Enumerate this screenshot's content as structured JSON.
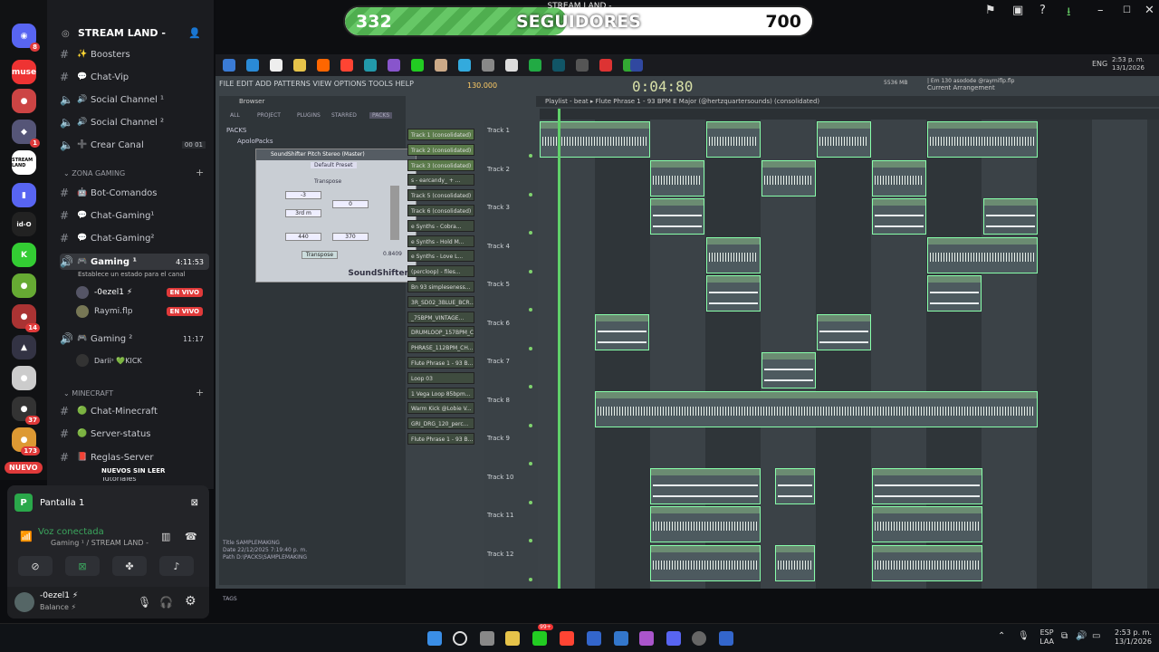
{
  "overlay": {
    "stream_title": "STREAM LAND -",
    "current": "332",
    "label": "SEGUIDORES",
    "goal": "700",
    "fill_fraction": 0.474
  },
  "servers": {
    "discord_badge": "8",
    "muse": "muse",
    "badge1": "1",
    "badge37": "37",
    "badge173": "173",
    "badge14": "14",
    "nuevo": "NUEVO",
    "id0": "id-O",
    "stream": "STREAM LAND"
  },
  "guild": {
    "name": "STREAM LAND -"
  },
  "channels": [
    {
      "name": "Boosters",
      "emoji": "✨"
    },
    {
      "name": "Chat-Vip",
      "emoji": "💬"
    },
    {
      "name": "Social Channel ¹",
      "emoji": "🔊"
    },
    {
      "name": "Social Channel ²",
      "emoji": "🔊"
    },
    {
      "name": "Crear Canal",
      "emoji": "➕",
      "count": "00",
      "count2": "01"
    }
  ],
  "cat_gaming": "ZONA GAMING",
  "gaming_channels": [
    {
      "name": "Bot-Comandos",
      "emoji": "🤖"
    },
    {
      "name": "Chat-Gaming¹",
      "emoji": "💬"
    },
    {
      "name": "Chat-Gaming²",
      "emoji": "💬"
    }
  ],
  "voice1": {
    "name": "Gaming ¹",
    "time": "4:11:53",
    "status": "Establece un estado para el canal"
  },
  "voice1_users": [
    {
      "name": "-0ezel1 ⚡",
      "live": "EN VIVO"
    },
    {
      "name": "Raymi.flp",
      "live": "EN VIVO"
    }
  ],
  "voice2": {
    "name": "Gaming ²",
    "time": "11:17"
  },
  "voice2_user": {
    "name": "Dariiˢ 💚KICK"
  },
  "cat_minecraft": "MINECRAFT",
  "mc_channels": [
    {
      "name": "Chat-Minecraft",
      "emoji": "🟢"
    },
    {
      "name": "Server-status",
      "emoji": "🟢"
    },
    {
      "name": "Reglas-Server",
      "emoji": "📕"
    }
  ],
  "tutoriales": "Tutoriales",
  "new_unread": "NUEVOS SIN LEER",
  "screen": {
    "label": "Pantalla 1"
  },
  "voice_conn": {
    "title": "Voz conectada",
    "sub": "Gaming ¹ / STREAM LAND -"
  },
  "user": {
    "name": "-0ezel1 ⚡",
    "status": "Balance ⚡"
  },
  "fl": {
    "menu": "FILE  EDIT  ADD  PATTERNS  VIEW  OPTIONS  TOOLS  HELP",
    "tempo": "130.000",
    "time": "0:04:80",
    "hint": "Current Arrangement",
    "hint2": "| Em 130 asodode @raymiflp.flp",
    "mem": "5536 MB",
    "browser_title": "Browser",
    "tabs": [
      "ALL",
      "PROJECT",
      "PLUGINS",
      "STARRED",
      "PACKS"
    ],
    "packs": [
      "PACKS",
      "ApoloPacks"
    ],
    "plugin_title": "SoundShifter Pitch Stereo (Master)",
    "plugin_preset": "Default Preset",
    "plugin_name": "SoundShifter",
    "plugin_fields": {
      "transpose": "Transpose",
      "semitones": "-3",
      "cents": "0",
      "interval": "3rd m",
      "source": "440",
      "dest": "370",
      "ratio": "0.8409",
      "mode": "Transpose"
    },
    "fileinfo": [
      "Title   SAMPLEMAKING",
      "Date    22/12/2025 7:19:40 p. m.",
      "Path    D:\\PACKS\\SAMPLEMAKING"
    ],
    "tags": "TAGS",
    "playlist": "Playlist - beat ▸ Flute Phrase 1 - 93 BPM E Major (@hertzquartersounds) (consolidated)",
    "rack": [
      "Track 1 (consolidated)",
      "Track 2 (consolidated)",
      "Track 3 (consolidated)",
      "s - earcandy_ + ...",
      "Track 5 (consolidated)",
      "Track 6 (consolidated)",
      "e Synths - Cobra...",
      "e Synths - Hold M...",
      "e Synths - Love L...",
      "(percloop) - files...",
      "Bn 93 simpleseness...",
      "3R_SD02_3BLUE_BCR...",
      "_75BPM_VINTAGE...",
      "DRUMLOOP_157BPM_CH...",
      "PHRASE_112BPM_CH...",
      "Flute Phrase 1 - 93 B...",
      "Loop 03",
      "1 Vega Loop 85bpm...",
      "Warm Kick @Lobie V...",
      "GRI_DRG_120_perc...",
      "Flute Phrase 1 - 93 B..."
    ],
    "tracks": [
      "Track 1",
      "Track 2",
      "Track 3",
      "Track 4",
      "Track 5",
      "Track 6",
      "Track 7",
      "Track 8",
      "Track 9",
      "Track 10",
      "Track 11",
      "Track 12"
    ]
  },
  "tray": {
    "lang": "ESP",
    "lang2": "LAA",
    "time": "2:53 p. m.",
    "date": "13/1/2026"
  },
  "fl_clock": {
    "time": "2:53 p. m.",
    "date": "13/1/2026"
  },
  "taskbar_badge": "99+"
}
